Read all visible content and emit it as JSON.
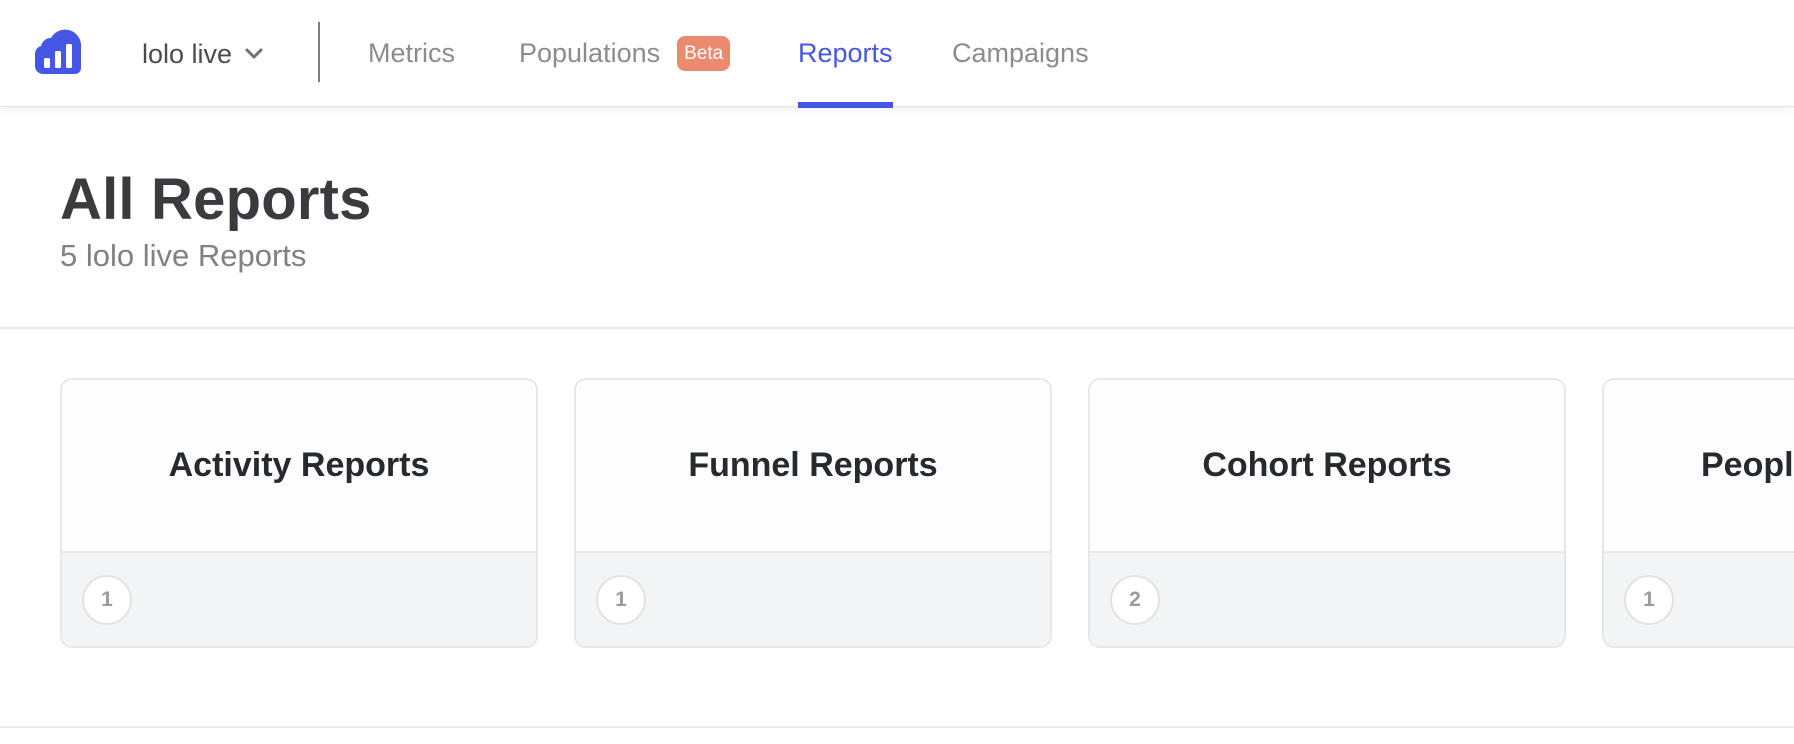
{
  "header": {
    "project_name": "lolo live",
    "nav": [
      {
        "label": "Metrics"
      },
      {
        "label": "Populations",
        "badge": "Beta"
      },
      {
        "label": "Reports"
      },
      {
        "label": "Campaigns"
      }
    ],
    "active_tab": "Reports"
  },
  "page": {
    "title": "All Reports",
    "subtitle": "5 lolo live Reports"
  },
  "cards": [
    {
      "title": "Activity Reports",
      "count": "1"
    },
    {
      "title": "Funnel Reports",
      "count": "1"
    },
    {
      "title": "Cohort Reports",
      "count": "2"
    },
    {
      "title": "Peopl",
      "count": "1"
    }
  ],
  "colors": {
    "accent": "#4657e5",
    "beta_badge": "#ec8a6f"
  },
  "icons": {
    "logo": "bar-chart-cloud-logo",
    "project_dropdown": "chevron-down-icon"
  }
}
